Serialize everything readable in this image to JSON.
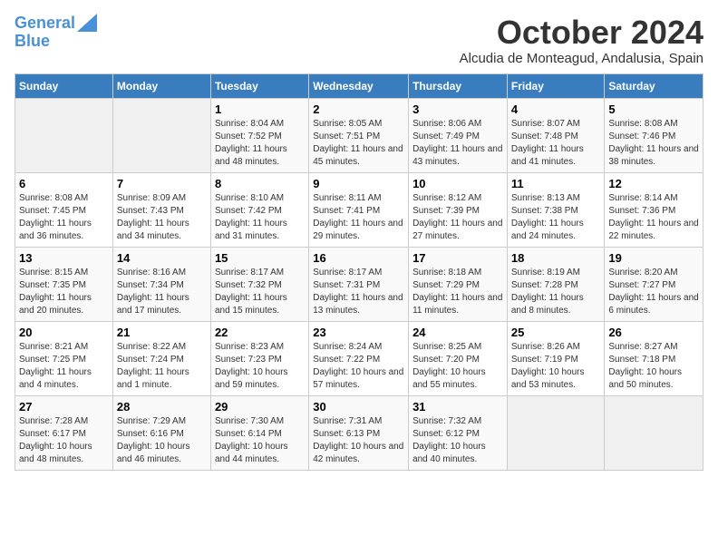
{
  "header": {
    "logo_line1": "General",
    "logo_line2": "Blue",
    "month": "October 2024",
    "location": "Alcudia de Monteagud, Andalusia, Spain"
  },
  "days_of_week": [
    "Sunday",
    "Monday",
    "Tuesday",
    "Wednesday",
    "Thursday",
    "Friday",
    "Saturday"
  ],
  "weeks": [
    [
      {
        "day": "",
        "sunrise": "",
        "sunset": "",
        "daylight": ""
      },
      {
        "day": "",
        "sunrise": "",
        "sunset": "",
        "daylight": ""
      },
      {
        "day": "1",
        "sunrise": "Sunrise: 8:04 AM",
        "sunset": "Sunset: 7:52 PM",
        "daylight": "Daylight: 11 hours and 48 minutes."
      },
      {
        "day": "2",
        "sunrise": "Sunrise: 8:05 AM",
        "sunset": "Sunset: 7:51 PM",
        "daylight": "Daylight: 11 hours and 45 minutes."
      },
      {
        "day": "3",
        "sunrise": "Sunrise: 8:06 AM",
        "sunset": "Sunset: 7:49 PM",
        "daylight": "Daylight: 11 hours and 43 minutes."
      },
      {
        "day": "4",
        "sunrise": "Sunrise: 8:07 AM",
        "sunset": "Sunset: 7:48 PM",
        "daylight": "Daylight: 11 hours and 41 minutes."
      },
      {
        "day": "5",
        "sunrise": "Sunrise: 8:08 AM",
        "sunset": "Sunset: 7:46 PM",
        "daylight": "Daylight: 11 hours and 38 minutes."
      }
    ],
    [
      {
        "day": "6",
        "sunrise": "Sunrise: 8:08 AM",
        "sunset": "Sunset: 7:45 PM",
        "daylight": "Daylight: 11 hours and 36 minutes."
      },
      {
        "day": "7",
        "sunrise": "Sunrise: 8:09 AM",
        "sunset": "Sunset: 7:43 PM",
        "daylight": "Daylight: 11 hours and 34 minutes."
      },
      {
        "day": "8",
        "sunrise": "Sunrise: 8:10 AM",
        "sunset": "Sunset: 7:42 PM",
        "daylight": "Daylight: 11 hours and 31 minutes."
      },
      {
        "day": "9",
        "sunrise": "Sunrise: 8:11 AM",
        "sunset": "Sunset: 7:41 PM",
        "daylight": "Daylight: 11 hours and 29 minutes."
      },
      {
        "day": "10",
        "sunrise": "Sunrise: 8:12 AM",
        "sunset": "Sunset: 7:39 PM",
        "daylight": "Daylight: 11 hours and 27 minutes."
      },
      {
        "day": "11",
        "sunrise": "Sunrise: 8:13 AM",
        "sunset": "Sunset: 7:38 PM",
        "daylight": "Daylight: 11 hours and 24 minutes."
      },
      {
        "day": "12",
        "sunrise": "Sunrise: 8:14 AM",
        "sunset": "Sunset: 7:36 PM",
        "daylight": "Daylight: 11 hours and 22 minutes."
      }
    ],
    [
      {
        "day": "13",
        "sunrise": "Sunrise: 8:15 AM",
        "sunset": "Sunset: 7:35 PM",
        "daylight": "Daylight: 11 hours and 20 minutes."
      },
      {
        "day": "14",
        "sunrise": "Sunrise: 8:16 AM",
        "sunset": "Sunset: 7:34 PM",
        "daylight": "Daylight: 11 hours and 17 minutes."
      },
      {
        "day": "15",
        "sunrise": "Sunrise: 8:17 AM",
        "sunset": "Sunset: 7:32 PM",
        "daylight": "Daylight: 11 hours and 15 minutes."
      },
      {
        "day": "16",
        "sunrise": "Sunrise: 8:17 AM",
        "sunset": "Sunset: 7:31 PM",
        "daylight": "Daylight: 11 hours and 13 minutes."
      },
      {
        "day": "17",
        "sunrise": "Sunrise: 8:18 AM",
        "sunset": "Sunset: 7:29 PM",
        "daylight": "Daylight: 11 hours and 11 minutes."
      },
      {
        "day": "18",
        "sunrise": "Sunrise: 8:19 AM",
        "sunset": "Sunset: 7:28 PM",
        "daylight": "Daylight: 11 hours and 8 minutes."
      },
      {
        "day": "19",
        "sunrise": "Sunrise: 8:20 AM",
        "sunset": "Sunset: 7:27 PM",
        "daylight": "Daylight: 11 hours and 6 minutes."
      }
    ],
    [
      {
        "day": "20",
        "sunrise": "Sunrise: 8:21 AM",
        "sunset": "Sunset: 7:25 PM",
        "daylight": "Daylight: 11 hours and 4 minutes."
      },
      {
        "day": "21",
        "sunrise": "Sunrise: 8:22 AM",
        "sunset": "Sunset: 7:24 PM",
        "daylight": "Daylight: 11 hours and 1 minute."
      },
      {
        "day": "22",
        "sunrise": "Sunrise: 8:23 AM",
        "sunset": "Sunset: 7:23 PM",
        "daylight": "Daylight: 10 hours and 59 minutes."
      },
      {
        "day": "23",
        "sunrise": "Sunrise: 8:24 AM",
        "sunset": "Sunset: 7:22 PM",
        "daylight": "Daylight: 10 hours and 57 minutes."
      },
      {
        "day": "24",
        "sunrise": "Sunrise: 8:25 AM",
        "sunset": "Sunset: 7:20 PM",
        "daylight": "Daylight: 10 hours and 55 minutes."
      },
      {
        "day": "25",
        "sunrise": "Sunrise: 8:26 AM",
        "sunset": "Sunset: 7:19 PM",
        "daylight": "Daylight: 10 hours and 53 minutes."
      },
      {
        "day": "26",
        "sunrise": "Sunrise: 8:27 AM",
        "sunset": "Sunset: 7:18 PM",
        "daylight": "Daylight: 10 hours and 50 minutes."
      }
    ],
    [
      {
        "day": "27",
        "sunrise": "Sunrise: 7:28 AM",
        "sunset": "Sunset: 6:17 PM",
        "daylight": "Daylight: 10 hours and 48 minutes."
      },
      {
        "day": "28",
        "sunrise": "Sunrise: 7:29 AM",
        "sunset": "Sunset: 6:16 PM",
        "daylight": "Daylight: 10 hours and 46 minutes."
      },
      {
        "day": "29",
        "sunrise": "Sunrise: 7:30 AM",
        "sunset": "Sunset: 6:14 PM",
        "daylight": "Daylight: 10 hours and 44 minutes."
      },
      {
        "day": "30",
        "sunrise": "Sunrise: 7:31 AM",
        "sunset": "Sunset: 6:13 PM",
        "daylight": "Daylight: 10 hours and 42 minutes."
      },
      {
        "day": "31",
        "sunrise": "Sunrise: 7:32 AM",
        "sunset": "Sunset: 6:12 PM",
        "daylight": "Daylight: 10 hours and 40 minutes."
      },
      {
        "day": "",
        "sunrise": "",
        "sunset": "",
        "daylight": ""
      },
      {
        "day": "",
        "sunrise": "",
        "sunset": "",
        "daylight": ""
      }
    ]
  ]
}
